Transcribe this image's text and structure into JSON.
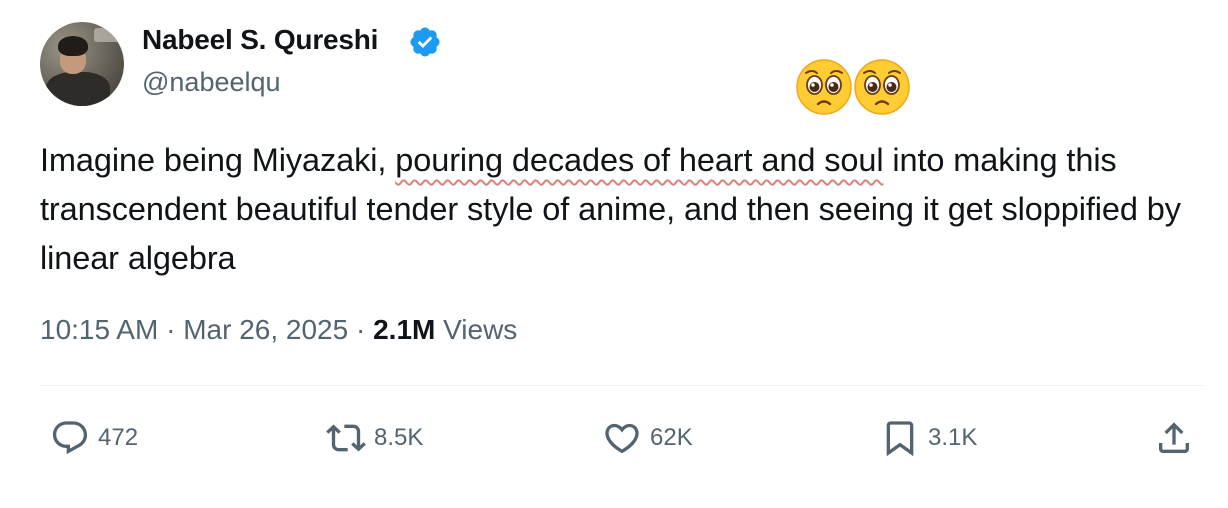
{
  "tweet": {
    "author": {
      "display_name": "Nabeel S. Qureshi",
      "handle": "@nabeelqu",
      "verified": true
    },
    "text_before": "Imagine being Miyazaki, ",
    "text_highlight": "pouring decades of heart and soul",
    "text_after": " into making this transcendent beautiful tender style of anime, and then seeing it get sloppified by linear algebra",
    "reaction_emoji": "🥺🥺",
    "time": "10:15 AM",
    "date": "Mar 26, 2025",
    "separator": "·",
    "views_count": "2.1M",
    "views_label": "Views"
  },
  "actions": {
    "replies": "472",
    "reposts": "8.5K",
    "likes": "62K",
    "bookmarks": "3.1K"
  },
  "colors": {
    "verified_blue": "#1d9bf0",
    "muted_text": "#536471",
    "underline": "#d9827a"
  },
  "icons": [
    "verified-badge-icon",
    "pleading-face-emoji",
    "reply-icon",
    "repost-icon",
    "like-icon",
    "bookmark-icon",
    "share-icon"
  ]
}
